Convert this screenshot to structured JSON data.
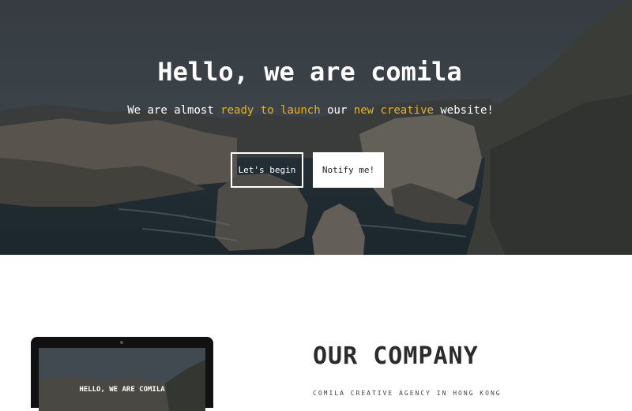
{
  "hero": {
    "title": "Hello, we are comila",
    "subtitle_parts": {
      "p1": "We are almost ",
      "h1": "ready to launch",
      "p2": " our ",
      "h2": "new creative",
      "p3": " website!"
    },
    "buttons": {
      "begin_label": "Let's begin",
      "notify_label": "Notify me!"
    }
  },
  "about": {
    "heading": "OUR COMPANY",
    "text": "COMILA CREATIVE AGENCY IN HONG KONG",
    "laptop_screen_title": "HELLO, WE ARE COMILA"
  },
  "colors": {
    "accent": "#e8b321",
    "text_dark": "#2b2b2b",
    "hero_overlay": "#3d4a52"
  }
}
